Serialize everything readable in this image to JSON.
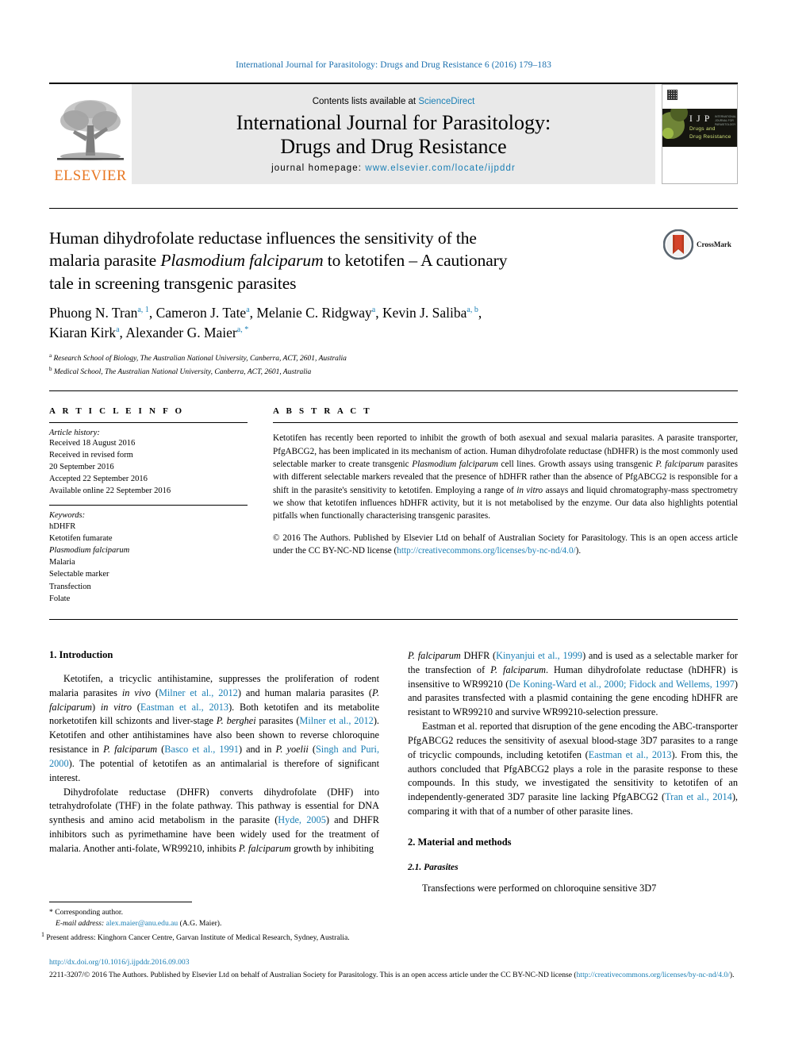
{
  "running_head": "International Journal for Parasitology: Drugs and Drug Resistance 6 (2016) 179–183",
  "masthead": {
    "publisher": "ELSEVIER",
    "contents_prefix": "Contents lists available at ",
    "contents_link": "ScienceDirect",
    "journal_title_line1": "International Journal for Parasitology:",
    "journal_title_line2": "Drugs and Drug Resistance",
    "homepage_label": "journal homepage: ",
    "homepage_url": "www.elsevier.com/locate/ijpddr",
    "cover": {
      "acronym": "I J P",
      "acronym_small": "INTERNATIONAL\nJOURNAL FOR\nPARASITOLOGY",
      "subtitle_line1": "Drugs and",
      "subtitle_line2": "Drug Resistance"
    }
  },
  "title": {
    "line1": "Human dihydrofolate reductase influences the sensitivity of the",
    "line2_a": "malaria parasite ",
    "line2_italic": "Plasmodium falciparum",
    "line2_b": " to ketotifen – A cautionary",
    "line3": "tale in screening transgenic parasites",
    "crossmark_label": "CrossMark"
  },
  "authors": {
    "line1": "Phuong N. Tran",
    "line1_sup1": "a, 1",
    "a2": "Cameron J. Tate",
    "a2_sup": "a",
    "a3": "Melanie C. Ridgway",
    "a3_sup": "a",
    "a4": "Kevin J. Saliba",
    "a4_sup": "a, b",
    "a5": "Kiaran Kirk",
    "a5_sup": "a",
    "a6": "Alexander G. Maier",
    "a6_sup": "a, *"
  },
  "affiliations": [
    {
      "mark": "a",
      "text": "Research School of Biology, The Australian National University, Canberra, ACT, 2601, Australia"
    },
    {
      "mark": "b",
      "text": "Medical School, The Australian National University, Canberra, ACT, 2601, Australia"
    }
  ],
  "article_info": {
    "heading": "A R T I C L E   I N F O",
    "history_label": "Article history:",
    "history": [
      "Received 18 August 2016",
      "Received in revised form",
      "20 September 2016",
      "Accepted 22 September 2016",
      "Available online 22 September 2016"
    ],
    "keywords_label": "Keywords:",
    "keywords": [
      "hDHFR",
      "Ketotifen fumarate",
      "Plasmodium falciparum",
      "Malaria",
      "Selectable marker",
      "Transfection",
      "Folate"
    ],
    "keywords_italic_index": 2
  },
  "abstract": {
    "heading": "A B S T R A C T",
    "p1_a": "Ketotifen has recently been reported to inhibit the growth of both asexual and sexual malaria parasites. A parasite transporter, PfgABCG2, has been implicated in its mechanism of action. Human dihydrofolate reductase (hDHFR) is the most commonly used selectable marker to create transgenic ",
    "p1_it1": "Plasmodium falciparum",
    "p1_b": " cell lines. Growth assays using transgenic ",
    "p1_it2": "P. falciparum",
    "p1_c": " parasites with different selectable markers revealed that the presence of hDHFR rather than the absence of PfgABCG2 is responsible for a shift in the parasite's sensitivity to ketotifen. Employing a range of ",
    "p1_it3": "in vitro",
    "p1_d": " assays and liquid chromatography-mass spectrometry we show that ketotifen influences hDHFR activity, but it is not metabolised by the enzyme. Our data also highlights potential pitfalls when functionally characterising transgenic parasites.",
    "copyright_a": "© 2016 The Authors. Published by Elsevier Ltd on behalf of Australian Society for Parasitology. This is an open access article under the CC BY-NC-ND license (",
    "copyright_link": "http://creativecommons.org/licenses/by-nc-nd/4.0/",
    "copyright_b": ")."
  },
  "body": {
    "intro_heading": "1.  Introduction",
    "left": {
      "p1_a": "Ketotifen, a tricyclic antihistamine, suppresses the proliferation of rodent malaria parasites ",
      "p1_it1": "in vivo",
      "p1_b": " (",
      "p1_ref1": "Milner et al., 2012",
      "p1_c": ") and human malaria parasites (",
      "p1_it2": "P. falciparum",
      "p1_d": ") ",
      "p1_it3": "in vitro",
      "p1_e": " (",
      "p1_ref2": "Eastman et al., 2013",
      "p1_f": "). Both ketotifen and its metabolite norketotifen kill schizonts and liver-stage ",
      "p1_it4": "P. berghei",
      "p1_g": " parasites (",
      "p1_ref3": "Milner et al., 2012",
      "p1_h": "). Ketotifen and other antihistamines have also been shown to reverse chloroquine resistance in ",
      "p1_it5": "P. falciparum",
      "p1_i": " (",
      "p1_ref4": "Basco et al., 1991",
      "p1_j": ") and in ",
      "p1_it6": "P. yoelii",
      "p1_k": " (",
      "p1_ref5": "Singh and Puri, 2000",
      "p1_l": "). The potential of ketotifen as an antimalarial is therefore of significant interest.",
      "p2_a": "Dihydrofolate reductase (DHFR) converts dihydrofolate (DHF) into tetrahydrofolate (THF) in the folate pathway. This pathway is essential for DNA synthesis and amino acid metabolism in the parasite (",
      "p2_ref1": "Hyde, 2005",
      "p2_b": ") and DHFR inhibitors such as pyrimethamine have been widely used for the treatment of malaria. Another anti-folate, WR99210, inhibits ",
      "p2_it1": "P. falciparum",
      "p2_c": " growth by inhibiting"
    },
    "right": {
      "p1_it1": "P. falciparum",
      "p1_a": " DHFR (",
      "p1_ref1": "Kinyanjui et al., 1999",
      "p1_b": ") and is used as a selectable marker for the transfection of ",
      "p1_it2": "P. falciparum",
      "p1_c": ". Human dihydrofolate reductase (hDHFR) is insensitive to WR99210 (",
      "p1_ref2": "De Koning-Ward et al., 2000; Fidock and Wellems, 1997",
      "p1_d": ") and parasites transfected with a plasmid containing the gene encoding hDHFR are resistant to WR99210 and survive WR99210-selection pressure.",
      "p2_a": "Eastman et al. reported that disruption of the gene encoding the ABC-transporter PfgABCG2 reduces the sensitivity of asexual blood-stage 3D7 parasites to a range of tricyclic compounds, including ketotifen (",
      "p2_ref1": "Eastman et al., 2013",
      "p2_b": "). From this, the authors concluded that PfgABCG2 plays a role in the parasite response to these compounds. In this study, we investigated the sensitivity to ketotifen of an independently-generated 3D7 parasite line lacking PfgABCG2 (",
      "p2_ref2": "Tran et al., 2014",
      "p2_c": "), comparing it with that of a number of other parasite lines.",
      "methods_heading": "2.  Material and methods",
      "sub_heading": "2.1.  Parasites",
      "p3": "Transfections were performed on chloroquine sensitive 3D7"
    }
  },
  "footnotes": {
    "corresponding": "* Corresponding author.",
    "email_label": "E-mail address:",
    "email": "alex.maier@anu.edu.au",
    "email_suffix": "(A.G. Maier).",
    "present_mark": "1",
    "present_address": "Present address: Kinghorn Cancer Centre, Garvan Institute of Medical Research, Sydney, Australia."
  },
  "footer": {
    "doi": "http://dx.doi.org/10.1016/j.ijpddr.2016.09.003",
    "issn_copyright_a": "2211-3207/© 2016 The Authors. Published by Elsevier Ltd on behalf of Australian Society for Parasitology. This is an open access article under the CC BY-NC-ND license (",
    "issn_copyright_link1": "http://",
    "issn_copyright_link2": "creativecommons.org/licenses/by-nc-nd/4.0/",
    "issn_copyright_b": ")."
  },
  "colors": {
    "link": "#1a7fb5",
    "running_head": "#1a6fae",
    "elsevier_orange": "#e87722",
    "band_gray": "#e9e9e9"
  }
}
